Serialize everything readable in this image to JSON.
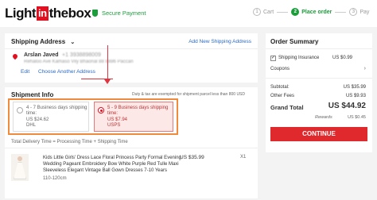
{
  "header": {
    "logo_part1": "Light",
    "logo_part2": "in",
    "logo_part3": "thebox",
    "secure_label": "Secure Payment",
    "steps": [
      {
        "num": "1",
        "label": "Cart"
      },
      {
        "num": "2",
        "label": "Place order"
      },
      {
        "num": "3",
        "label": "Pay"
      }
    ]
  },
  "shipping": {
    "title": "Shipping Address",
    "add_link": "Add New Shipping Address",
    "name": "Arslan Javed",
    "phone": "+1 3938898009",
    "address": "Rehaloo Ave Kamaso Vily Bhaonal 88 8886 Paccan",
    "edit_label": "Edit",
    "choose_label": "Choose Another Address"
  },
  "info": {
    "title": "Shipment Info",
    "note": "Duty & tax are exempted for shipment parcel less than 800 USD",
    "options": [
      {
        "line1": "4 - 7 Business days shipping",
        "line2": "time:",
        "price": "US $24.62",
        "carrier": "DHL"
      },
      {
        "line1": "5 - 9 Business days shipping",
        "line2": "time:",
        "price": "US $7.94",
        "carrier": "USPS"
      }
    ],
    "total_delivery": "Total Delivery Time = Processing Time + Shipping Time",
    "product": {
      "name_lines": [
        "Kids Little Girls' Dress Lace Floral Princess Party Formal Evening",
        "Wedding Pageant Embroidery Bow White Purple Red Tulle Maxi",
        "Sleeveless Elegant Vintage Ball Gown Dresses 7-10 Years"
      ],
      "size": "110-120cm",
      "price": "US $35.99",
      "qty": "X1"
    }
  },
  "order": {
    "title": "Order Summary",
    "insurance_label": "Shipping Insurance",
    "insurance_value": "US $0.99",
    "coupons_label": "Coupons",
    "subtotal_label": "Subtotal:",
    "subtotal_value": "US $35.99",
    "fees_label": "Other Fees",
    "fees_value": "US $9.93",
    "grand_label": "Grand Total",
    "grand_value": "US $44.92",
    "rewards_label": "Rewards",
    "rewards_value": "US $0.45",
    "continue_label": "CONTINUE"
  }
}
